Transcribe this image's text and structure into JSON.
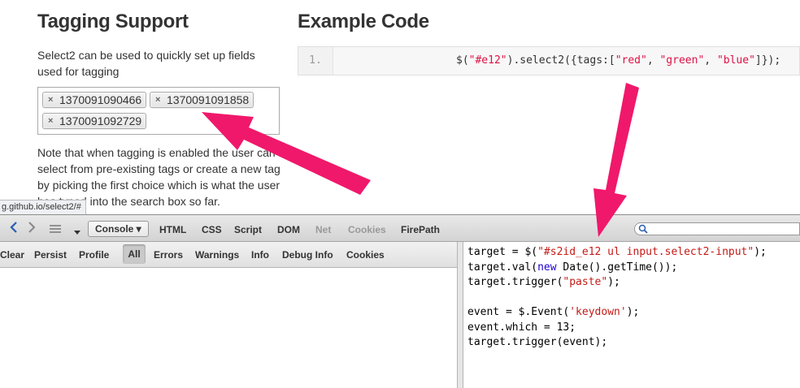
{
  "page": {
    "tagging_title": "Tagging Support",
    "example_title": "Example Code",
    "description1": "Select2 can be used to quickly set up fields used for tagging",
    "description2": "Note that when tagging is enabled the user can select from pre-existing tags or create a new tag by picking the first choice which is what the user has typed into the search box so far.",
    "tags": [
      "1370091090466",
      "1370091091858",
      "1370091092729"
    ],
    "tag_remove_glyph": "×",
    "code_line_number": "1.",
    "code": {
      "part1": "$(",
      "sel": "\"#e12\"",
      "part2": ").select2({tags:[",
      "t1": "\"red\"",
      "comma1": ", ",
      "t2": "\"green\"",
      "comma2": ", ",
      "t3": "\"blue\"",
      "part3": "]});"
    },
    "status_url": "g.github.io/select2/#"
  },
  "firebug": {
    "panel_tabs": [
      {
        "label": "Console ▾",
        "active": true
      },
      {
        "label": "HTML"
      },
      {
        "label": "CSS"
      },
      {
        "label": "Script"
      },
      {
        "label": "DOM"
      },
      {
        "label": "Net",
        "dim": true
      },
      {
        "label": "Cookies",
        "dim": true
      },
      {
        "label": "FirePath"
      }
    ],
    "sub_toolbar": [
      "Clear",
      "Persist",
      "Profile",
      "All",
      "Errors",
      "Warnings",
      "Info",
      "Debug Info",
      "Cookies"
    ],
    "command_editor": {
      "l1a": "target = $(",
      "l1s": "\"#s2id_e12 ul input.select2-input\"",
      "l1b": ");",
      "l2a": "target.val(",
      "l2k": "new",
      "l2b": " Date().getTime());",
      "l3a": "target.trigger(",
      "l3s": "\"paste\"",
      "l3b": ");",
      "l5a": "event = $.Event(",
      "l5s": "'keydown'",
      "l5b": ");",
      "l6": "event.which = 13;",
      "l7": "target.trigger(event);"
    }
  },
  "colors": {
    "annotation_arrow": "#f0186b",
    "string_red": "#d14"
  },
  "icons": [
    "back-icon",
    "forward-icon",
    "list-icon",
    "dropdown-icon",
    "search-icon",
    "remove-icon"
  ]
}
